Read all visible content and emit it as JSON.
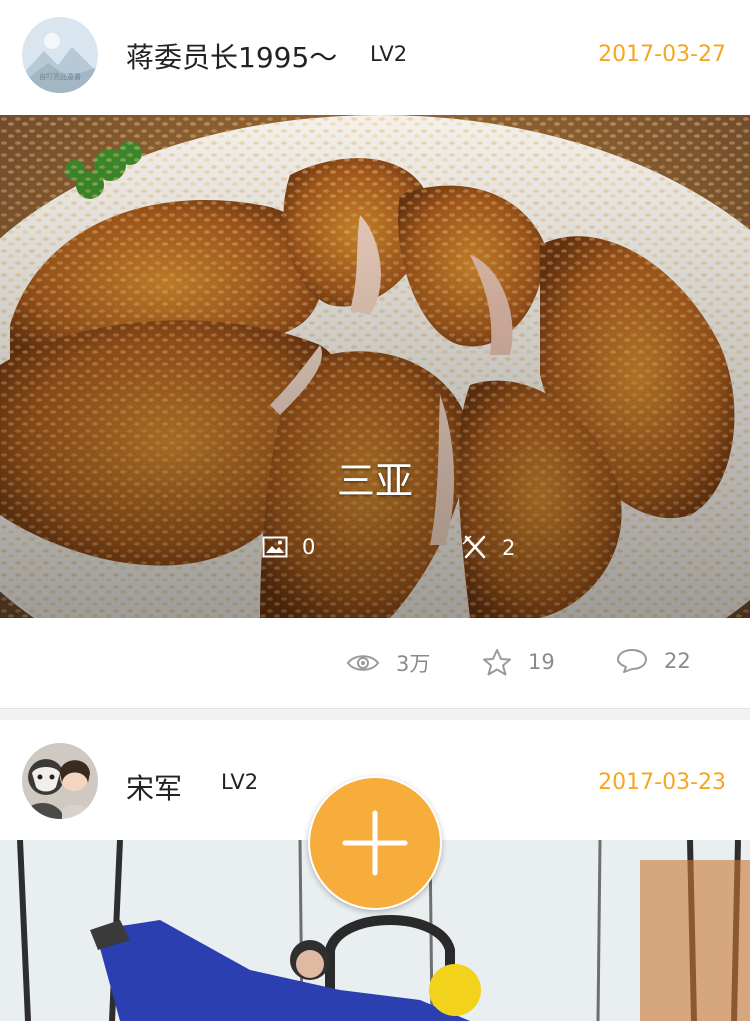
{
  "posts": [
    {
      "username": "蒋委员长1995～",
      "avatar_text": "自叮亮品童書",
      "level": "LV2",
      "date": "2017-03-27",
      "caption": "三亚",
      "photo_count": "0",
      "food_count": "2",
      "views": "3万",
      "favorites": "19",
      "comments": "22"
    },
    {
      "username": "宋军",
      "level": "LV2",
      "date": "2017-03-23"
    }
  ],
  "colors": {
    "accent": "#f5a623",
    "fab": "#f7ad3c",
    "muted": "#8a8a8a"
  },
  "icons": {
    "photo": "image-icon",
    "food": "fork-knife-icon",
    "views": "eye-icon",
    "favorites": "star-icon",
    "comments": "comment-icon",
    "add": "plus-icon"
  }
}
